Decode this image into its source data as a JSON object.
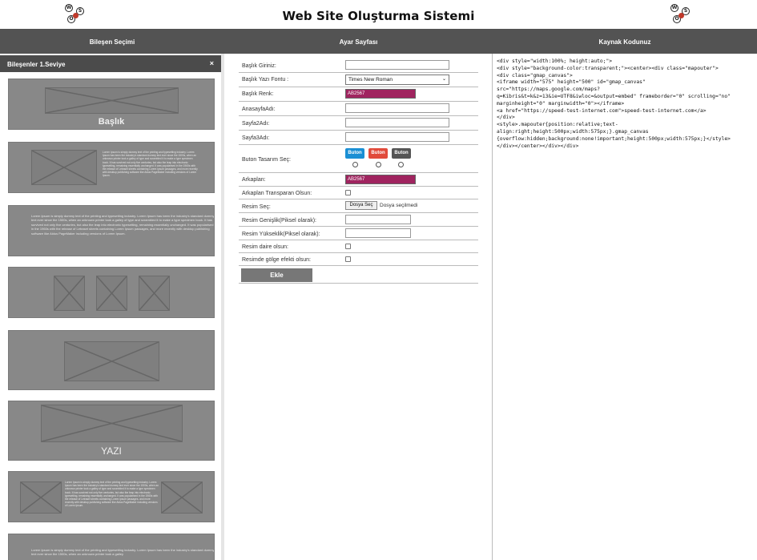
{
  "header": {
    "title": "Web Site Oluşturma Sistemi",
    "logo_letters": [
      "W",
      "S",
      "O"
    ]
  },
  "columns": {
    "left": "Bileşen Seçimi",
    "middle": "Ayar Sayfası",
    "right": "Kaynak Kodunuz"
  },
  "left_panel": {
    "title": "Bileşenler 1.Seviye",
    "close": "×",
    "cards": [
      {
        "caption": "Başlık"
      },
      {
        "text": "Lorem Ipsum is simply dummy text of the printing and typesetting industry. Lorem Ipsum has been the industry's standard dummy text ever since the 1500s, when an unknown printer took a galley of type and scrambled it to make a type specimen book. It has survived not only five centuries, but also the leap into electronic typesetting, remaining essentially unchanged. It was popularised in the 1960s with the release of Letraset sheets containing Lorem Ipsum passages, and more recently with desktop publishing software like Aldus PageMaker including versions of Lorem Ipsum."
      },
      {
        "text": "Lorem Ipsum is simply dummy text of the printing and typesetting industry. Lorem Ipsum has been the industry's standard dummy text ever since the 1500s, when an unknown printer took a galley of type and scrambled it to make a type specimen book. It has survived not only five centuries, but also the leap into electronic typesetting, remaining essentially unchanged. It was popularised in the 1960s with the release of Letraset sheets containing Lorem Ipsum passages, and more recently with desktop publishing software like Aldus PageMaker including versions of Lorem Ipsum."
      },
      {
        "caption": ""
      },
      {
        "caption": ""
      },
      {
        "caption": "YAZI"
      },
      {
        "text": "Lorem Ipsum is simply dummy text of the printing and typesetting industry. Lorem Ipsum has been the industry's standard dummy text ever since the 1500s, when an unknown printer took a galley of type and scrambled it to make a type specimen book. It has survived not only five centuries, but also the leap into electronic typesetting, remaining essentially unchanged. It was popularised in the 1960s with the release of Letraset sheets containing Lorem Ipsum passages, and more recently with desktop publishing software like Aldus PageMaker including versions of Lorem Ipsum."
      },
      {
        "text": "Lorem Ipsum is simply dummy text of the printing and typesetting industry. Lorem Ipsum has been the industry's standard dummy text ever since the 1500s, when an unknown printer took a galley"
      }
    ]
  },
  "form": {
    "baslik_label": "Başlık Giriniz:",
    "font_label": "Başlık Yazı Fontu :",
    "font_value": "Times New Roman",
    "color_label": "Başlık Renk:",
    "color_value": "AB2567",
    "anasayfa_label": "AnasayfaAdı:",
    "sayfa2_label": "Sayfa2Adı:",
    "sayfa3_label": "Sayfa3Adı:",
    "buton_label": "Buton Tasarım Seç:",
    "buton_options": [
      {
        "label": "Buton",
        "color": "#1a8fd4"
      },
      {
        "label": "Buton",
        "color": "#e14b3b"
      },
      {
        "label": "Buton",
        "color": "#555555"
      }
    ],
    "arkaplan_label": "Arkaplan:",
    "arkaplan_value": "AB2567",
    "transparan_label": "Arkaplan Transparan Olsun:",
    "resim_label": "Resim Seç:",
    "file_button": "Dosya Seç",
    "file_status": "Dosya seçilmedi",
    "genislik_label": "Resim Genişlik(Piksel olarak):",
    "yukseklik_label": "Resim Yükseklik(Piksel olarak):",
    "daire_label": "Resim daire olsun:",
    "golge_label": "Resimde gölge efekti olsun:",
    "submit": "Ekle"
  },
  "code": {
    "source": "<div style=\"width:100%; height:auto;\">\n<div style=\"background-color:transparent;\"><center><div class=\"mapouter\">\n<div class=\"gmap_canvas\">\n<iframe width=\"575\" height=\"500\" id=\"gmap_canvas\"\nsrc=\"https://maps.google.com/maps?\nq=Kibris&t=k&z=13&ie=UTF8&iwloc=&output=embed\" frameborder=\"0\" scrolling=\"no\"\nmarginheight=\"0\" marginwidth=\"0\"></iframe>\n<a href=\"https://speed-test-internet.com\">speed-test-internet.com</a>\n</div>\n<style>.mapouter{position:relative;text-\nalign:right;height:500px;width:575px;}.gmap_canvas\n{overflow:hidden;background:none!important;height:500px;width:575px;}</style>\n</div></center></div></div>"
  }
}
